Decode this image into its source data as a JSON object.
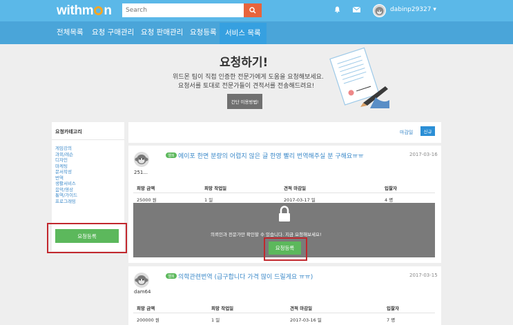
{
  "header": {
    "logo": "withm n",
    "search_placeholder": "Search",
    "username": "dabinp29327 ▾"
  },
  "nav": {
    "items": [
      "전체목록",
      "요청 구매관리",
      "요청 판매관리",
      "요청등록",
      "서비스 목록"
    ],
    "active": "서비스 목록"
  },
  "hero": {
    "title": "요청하기!",
    "subtitle_1": "위드몬 팀이 직접 인증한 전문가에게 도움을 요청해보세요.",
    "subtitle_2": "요청서를 토대로 전문가들이 견적서를 전송해드려요!",
    "howto_button": "간단 이용방법!"
  },
  "sidebar": {
    "title": "요청카테고리",
    "categories": [
      "게임강의",
      "과외/레슨",
      "디자인",
      "마케팅",
      "문서작성",
      "번역",
      "생활서비스",
      "음악/영상",
      "통역/가이드",
      "프로그래밍"
    ],
    "register_button": "요청등록"
  },
  "sort": {
    "deadline": "마감일",
    "new": "신규"
  },
  "table_headers": [
    "희망 금액",
    "희망 작업일",
    "견적 마감일",
    "입찰자"
  ],
  "requests": [
    {
      "user": "251...",
      "tag": "엘피",
      "title": "에이포 한면 분량의 어렵지 않은 글 한영 빨리 번역해주실 분 구해요ㅠㅠ",
      "date": "2017-03-16",
      "price": "25000 원",
      "work_days": "1 일",
      "deadline": "2017-03-17 일",
      "bidders": "4 명",
      "locked_message": "의뢰인과 전문가만 확인할 수 있습니다. 지금 요청해보세요!",
      "locked_button": "요청등록"
    },
    {
      "user": "dam64",
      "tag": "엘피",
      "title": "의학관련번역 (급구합니다 가격 많이 드릴게요 ㅠㅠ)",
      "date": "2017-03-15",
      "price": "200000 원",
      "work_days": "1 일",
      "deadline": "2017-03-16 일",
      "bidders": "7 명"
    }
  ],
  "colors": {
    "topbar": "#5bb8e8",
    "nav": "#4aa5d9",
    "search_button": "#e8643c",
    "green": "#5cb85c",
    "highlight": "#c1272d",
    "link": "#3b89c9"
  }
}
